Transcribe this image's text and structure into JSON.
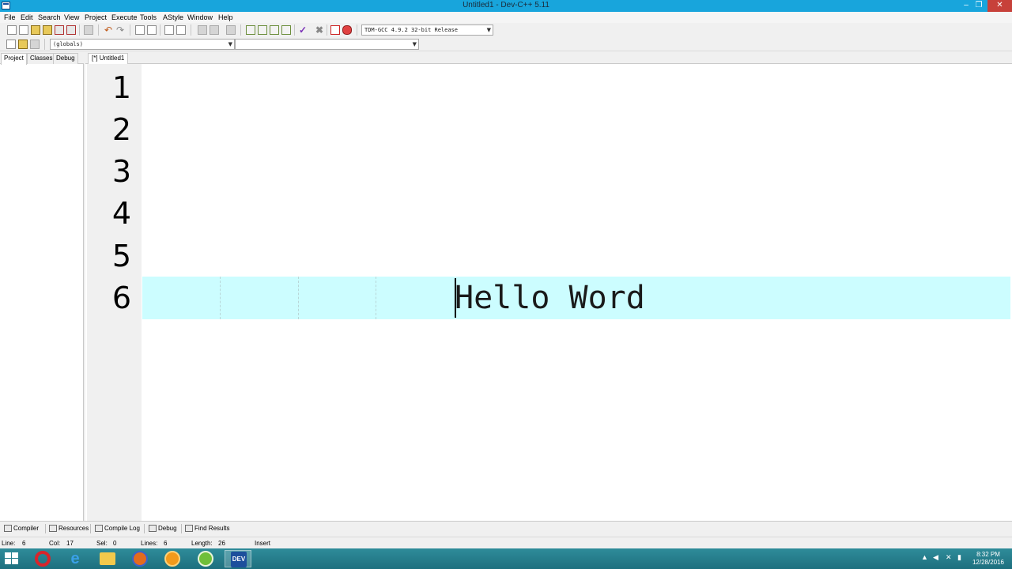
{
  "window": {
    "title": "Untitled1 - Dev-C++ 5.11",
    "minimize": "–",
    "maximize": "❐",
    "close": "✕"
  },
  "menu": [
    "File",
    "Edit",
    "Search",
    "View",
    "Project",
    "Execute",
    "Tools",
    "AStyle",
    "Window",
    "Help"
  ],
  "toolbar": {
    "compiler_select": "TDM-GCC 4.9.2 32-bit Release",
    "scope_select": "(globals)",
    "member_select": ""
  },
  "left_panel": {
    "tabs": [
      "Project",
      "Classes",
      "Debug"
    ]
  },
  "editor": {
    "tab_label": "[*] Untitled1",
    "line_numbers": [
      "1",
      "2",
      "3",
      "4",
      "5",
      "6"
    ],
    "current_line_text": "Hello Word"
  },
  "bottom_tabs": [
    "Compiler",
    "Resources",
    "Compile Log",
    "Debug",
    "Find Results"
  ],
  "status": {
    "line_label": "Line:",
    "line_value": "6",
    "col_label": "Col:",
    "col_value": "17",
    "sel_label": "Sel:",
    "sel_value": "0",
    "lines_label": "Lines:",
    "lines_value": "6",
    "length_label": "Length:",
    "length_value": "26",
    "mode": "Insert"
  },
  "taskbar": {
    "time": "8:32 PM",
    "date": "12/28/2016",
    "dev_label": "DEV"
  },
  "colors": {
    "titlebar": "#18a5dc",
    "current_line": "#ccfdff",
    "close_button": "#c7413a",
    "taskbar": "#1d6f7e"
  }
}
